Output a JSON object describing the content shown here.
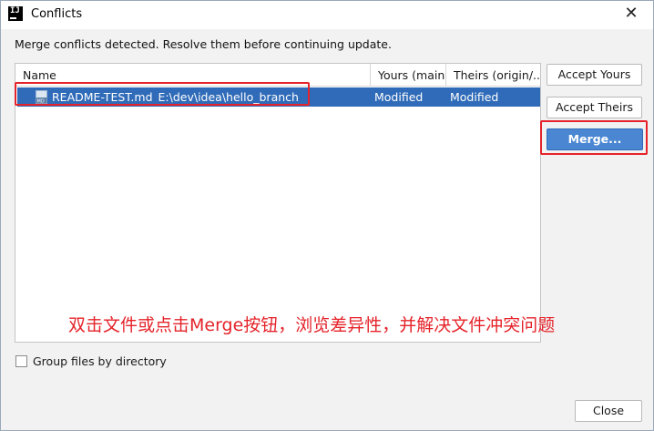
{
  "window": {
    "title": "Conflicts",
    "icon": "intellij-idea-icon",
    "close_glyph": "✕"
  },
  "message": "Merge conflicts detected. Resolve them before continuing update.",
  "table": {
    "columns": [
      "Name",
      "Yours (main)",
      "Theirs (origin/..."
    ],
    "rows": [
      {
        "file": "README-TEST.md",
        "path": "E:\\dev\\idea\\hello_branch",
        "yours": "Modified",
        "theirs": "Modified",
        "selected": true
      }
    ]
  },
  "buttons": {
    "accept_yours": "Accept Yours",
    "accept_theirs": "Accept Theirs",
    "merge": "Merge...",
    "close": "Close"
  },
  "group_files": {
    "label": "Group files by directory",
    "checked": false
  },
  "annotation": "双击文件或点击Merge按钮，浏览差异性，并解决文件冲突问题",
  "colors": {
    "selection": "#2f6bb8",
    "annotation": "#e5232a",
    "primary_button": "#4a86d2"
  }
}
